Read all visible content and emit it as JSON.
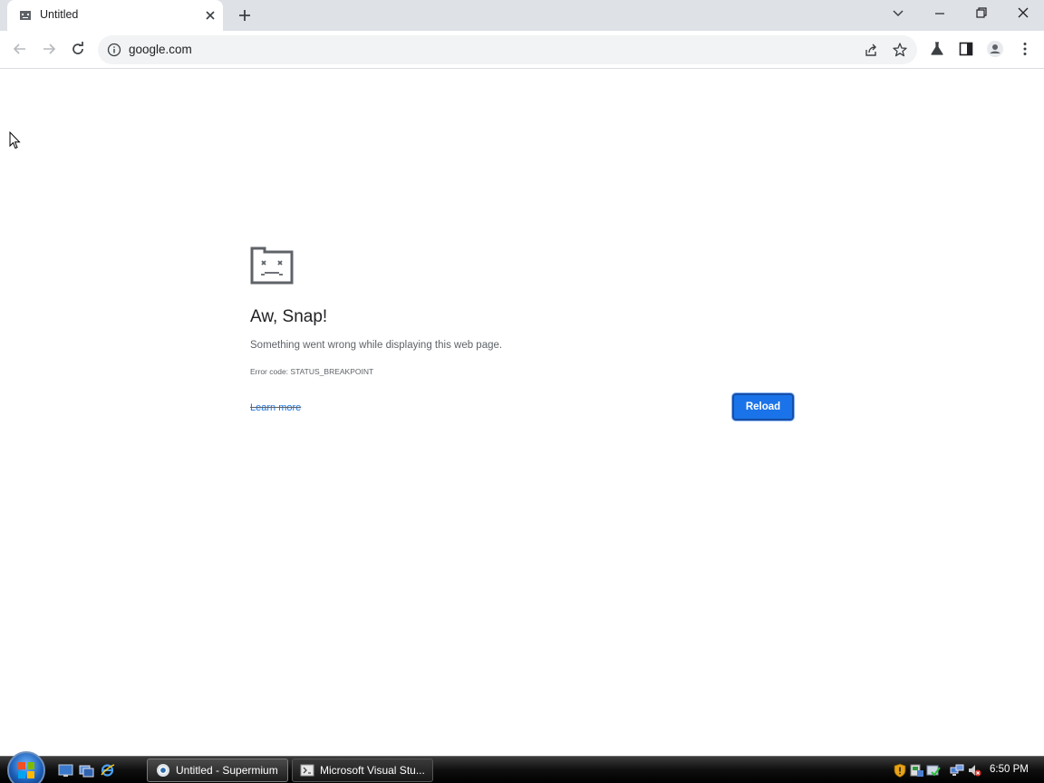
{
  "browser": {
    "tab": {
      "title": "Untitled"
    },
    "omnibox": {
      "url": "google.com"
    }
  },
  "error_page": {
    "title": "Aw, Snap!",
    "message": "Something went wrong while displaying this web page.",
    "error_code": "Error code: STATUS_BREAKPOINT",
    "learn_more": "Learn more",
    "reload_label": "Reload"
  },
  "taskbar": {
    "buttons": [
      {
        "label": "Untitled - Supermium",
        "active": true
      },
      {
        "label": "Microsoft Visual Stu...",
        "active": false
      }
    ],
    "clock": "6:50 PM"
  },
  "colors": {
    "accent": "#1a73e8",
    "tabstrip": "#dee1e6",
    "omnibox": "#f1f3f4"
  }
}
